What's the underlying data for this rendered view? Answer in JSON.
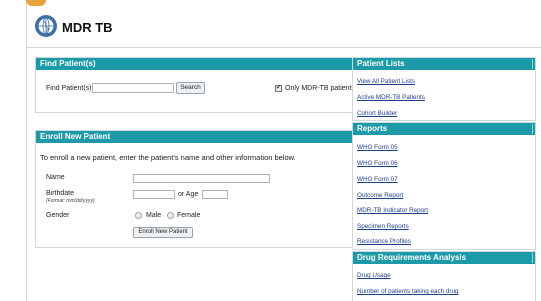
{
  "app": {
    "title": "MDR TB"
  },
  "find_patient": {
    "heading": "Find Patient(s)",
    "field_label": "Find Patient(s)",
    "search_value": "",
    "search_button": "Search",
    "only_mdr_label": "Only MDR-TB patients",
    "only_mdr_checked": true
  },
  "enroll": {
    "heading": "Enroll New Patient",
    "description": "To enroll a new patient, enter the patient's name and other information below.",
    "name_label": "Name",
    "birthdate_label": "Birthdate",
    "birthdate_hint": "(Format: mm/dd/yyyy)",
    "or_age_label": "or Age",
    "gender_label": "Gender",
    "gender_options": [
      "Male",
      "Female"
    ],
    "enroll_button": "Enroll New Patient"
  },
  "sidebar": {
    "patient_lists": {
      "heading": "Patient Lists",
      "links": [
        "View All Patient Lists",
        "Active MDR-TB Patients",
        "Cohort Builder"
      ]
    },
    "reports": {
      "heading": "Reports",
      "links": [
        "WHO Form 05",
        "WHO Form 06",
        "WHO Form 07",
        "Outcome Report",
        "MDR-TB Indicator Report",
        "Specimen Reports",
        "Resistance Profiles"
      ]
    },
    "drug_requirements": {
      "heading": "Drug Requirements Analysis",
      "links": [
        "Drug Usage",
        "Number of patients taking each drug"
      ]
    }
  },
  "colors": {
    "accent": "#1d9aa8",
    "link": "#1d3f8c",
    "logo": "#e8a23a"
  }
}
